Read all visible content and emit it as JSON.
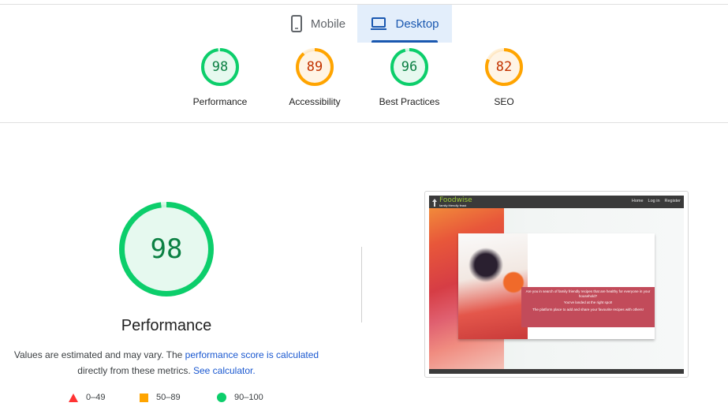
{
  "tabs": [
    {
      "label": "Mobile",
      "icon": "phone-icon",
      "active": false
    },
    {
      "label": "Desktop",
      "icon": "laptop-icon",
      "active": true
    }
  ],
  "categories": [
    {
      "label": "Performance",
      "score": "98",
      "status": "pass",
      "fraction": 0.98
    },
    {
      "label": "Accessibility",
      "score": "89",
      "status": "average",
      "fraction": 0.89
    },
    {
      "label": "Best Practices",
      "score": "96",
      "status": "pass",
      "fraction": 0.96
    },
    {
      "label": "SEO",
      "score": "82",
      "status": "average",
      "fraction": 0.82
    }
  ],
  "performance": {
    "score": "98",
    "fraction": 0.98,
    "title": "Performance",
    "note_before": "Values are estimated and may vary. The ",
    "note_link": "performance score is calculated",
    "note_middle": " directly from these metrics. ",
    "note_link2": "See calculator."
  },
  "legend": [
    {
      "range": "0–49",
      "shape": "triangle",
      "color": "#ff3333"
    },
    {
      "range": "50–89",
      "shape": "square",
      "color": "#ffa400"
    },
    {
      "range": "90–100",
      "shape": "circle",
      "color": "#0cce6b"
    }
  ],
  "colors": {
    "pass": "#0cce6b",
    "average": "#ffa400",
    "fail": "#ff3333",
    "accent": "#1a58b0"
  },
  "screenshot": {
    "brand": "Foodwise",
    "tagline": "family friendly feast",
    "nav": [
      "Home",
      "Log in",
      "Register"
    ],
    "hero_line1": "Are you in search of family friendly recipes that are healthy for everyone in your household?",
    "hero_line2": "You've landed at the right spot!",
    "hero_line3": "The platform place to add and share your favourite recipes with others!"
  }
}
